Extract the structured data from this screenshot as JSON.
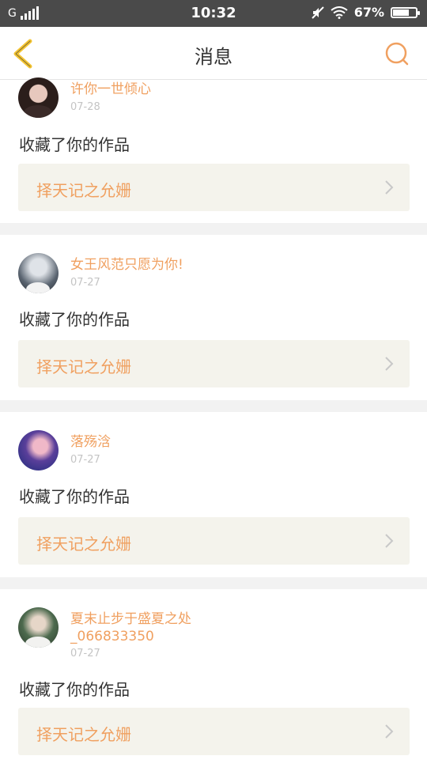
{
  "status_bar": {
    "carrier": "G",
    "time": "10:32",
    "battery": "67%",
    "battery_level": 0.67
  },
  "header": {
    "title": "消息"
  },
  "colors": {
    "accent": "#f0a060",
    "back_icon": "#f4c431",
    "card_bg": "#f4f3ec"
  },
  "messages": [
    {
      "username": "许你一世倾心",
      "date": "07-28",
      "action": "收藏了你的作品",
      "work_title": "择天记之允姗"
    },
    {
      "username": "女王风范只愿为你!",
      "date": "07-27",
      "action": "收藏了你的作品",
      "work_title": "择天记之允姗"
    },
    {
      "username": "落殇浛",
      "date": "07-27",
      "action": "收藏了你的作品",
      "work_title": "择天记之允姗"
    },
    {
      "username": "夏末止步于盛夏之处",
      "username_line2": "_066833350",
      "date": "07-27",
      "action": "收藏了你的作品",
      "work_title": "择天记之允姗"
    }
  ]
}
